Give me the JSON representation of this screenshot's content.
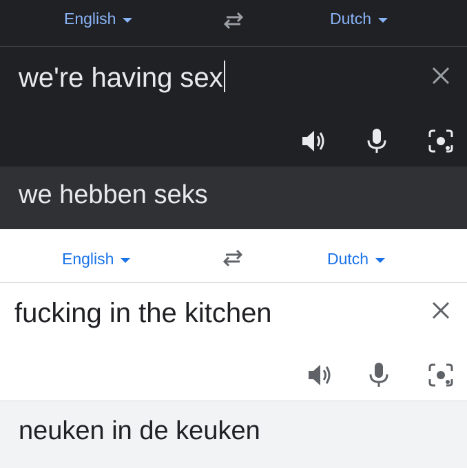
{
  "top_panel": {
    "source_language": "English",
    "target_language": "Dutch",
    "input_text": "we're having sex",
    "translation": "we hebben seks"
  },
  "bottom_panel": {
    "source_language": "English",
    "target_language": "Dutch",
    "input_text": "fucking in the kitchen",
    "translation": "neuken in de keuken"
  },
  "icons": [
    "swap-languages-icon",
    "clear-icon",
    "speaker-icon",
    "microphone-icon",
    "camera-icon"
  ],
  "colors": {
    "dark_bg": "#202124",
    "dark_result_bg": "#303134",
    "dark_link": "#8ab4f8",
    "light_link": "#1a73e8",
    "light_result_bg": "#f1f3f4"
  }
}
